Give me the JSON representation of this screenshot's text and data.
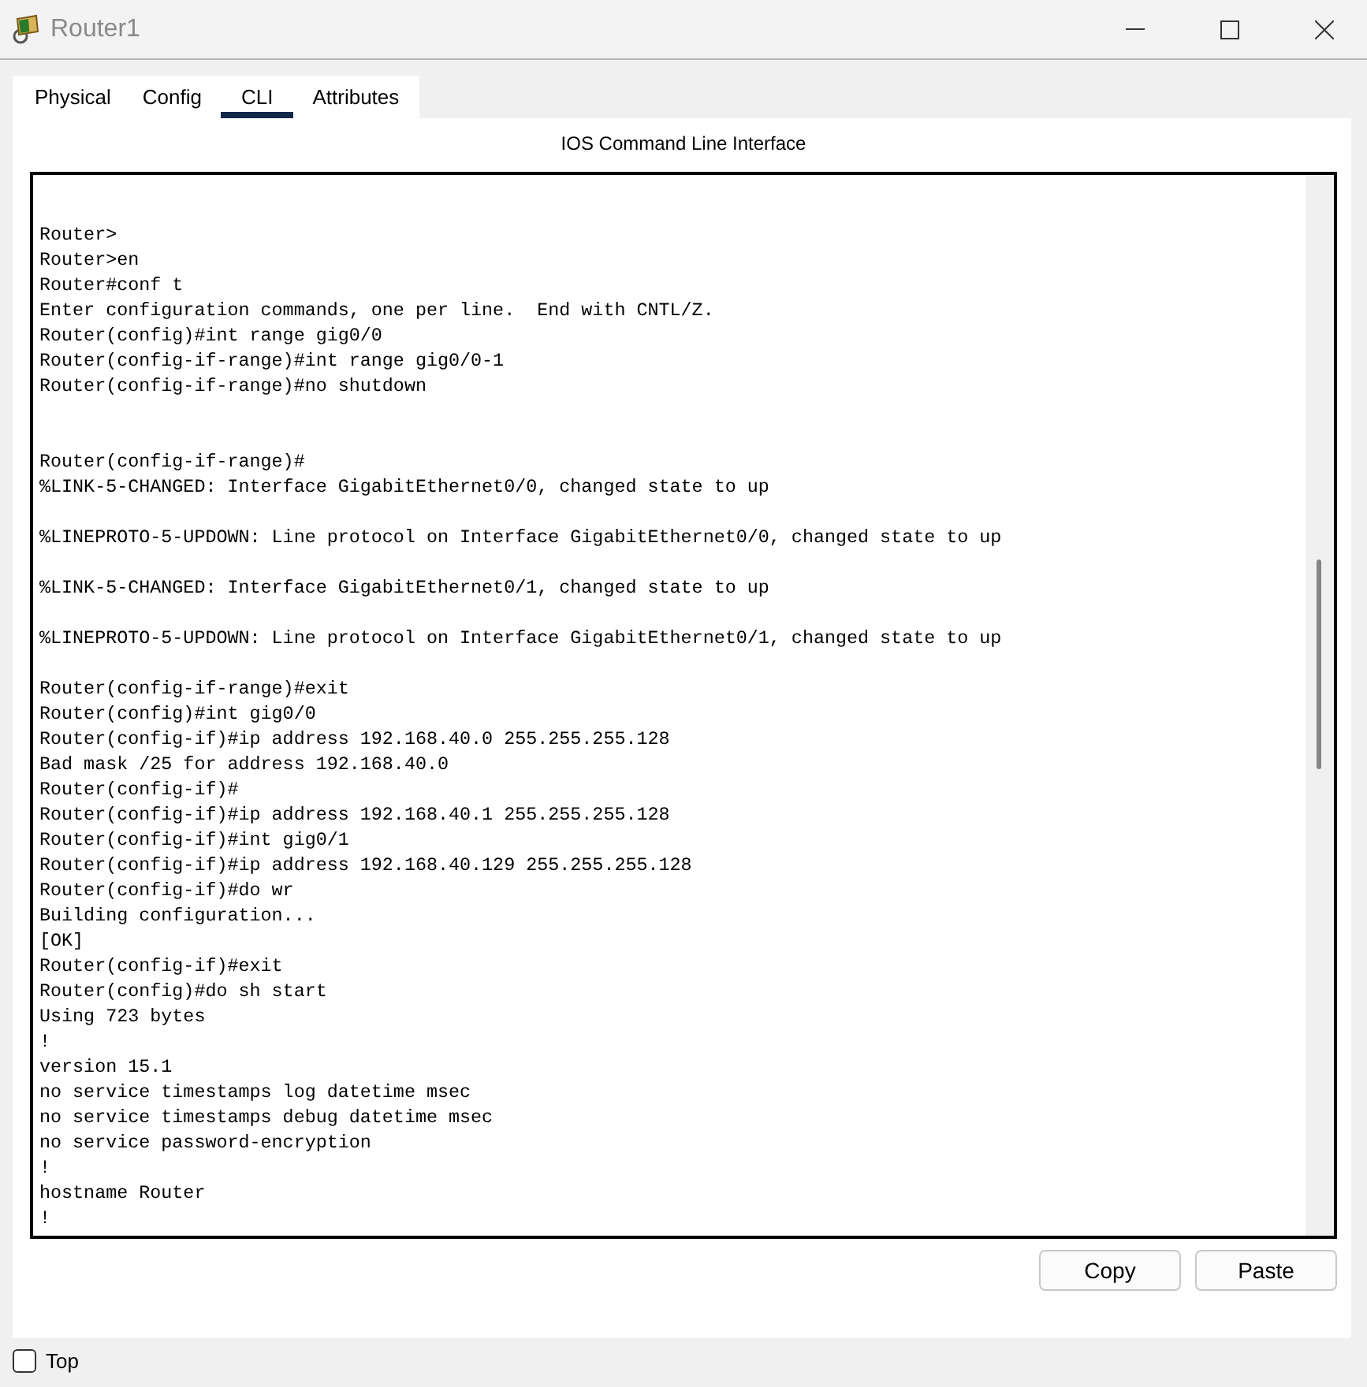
{
  "window": {
    "title": "Router1"
  },
  "tabs": [
    {
      "label": "Physical",
      "selected": false
    },
    {
      "label": "Config",
      "selected": false
    },
    {
      "label": "CLI",
      "selected": true
    },
    {
      "label": "Attributes",
      "selected": false
    }
  ],
  "panel_title": "IOS Command Line Interface",
  "terminal": {
    "lines": [
      {
        "text": "Router>"
      },
      {
        "text": "Router>en"
      },
      {
        "text": "Router#conf t"
      },
      {
        "text": "Enter configuration commands, one per line.  End with CNTL/Z."
      },
      {
        "text": "Router(config)#int range gig0/0"
      },
      {
        "text": "Router(config-if-range)#int range gig0/0-1"
      },
      {
        "text": "Router(config-if-range)#no shutdown"
      },
      {
        "text": "Router(config-if-range)#",
        "blank_before": true,
        "double_blank": true
      },
      {
        "text": "%LINK-5-CHANGED: Interface GigabitEthernet0/0, changed state to up"
      },
      {
        "text": "%LINEPROTO-5-UPDOWN: Line protocol on Interface GigabitEthernet0/0, changed state to up",
        "blank_before": true
      },
      {
        "text": "%LINK-5-CHANGED: Interface GigabitEthernet0/1, changed state to up",
        "blank_before": true
      },
      {
        "text": "%LINEPROTO-5-UPDOWN: Line protocol on Interface GigabitEthernet0/1, changed state to up",
        "blank_before": true
      },
      {
        "text": "Router(config-if-range)#exit",
        "blank_before": true
      },
      {
        "text": "Router(config)#int gig0/0"
      },
      {
        "text": "Router(config-if)#ip address 192.168.40.0 255.255.255.128"
      },
      {
        "text": "Bad mask /25 for address 192.168.40.0"
      },
      {
        "text": "Router(config-if)#"
      },
      {
        "text": "Router(config-if)#ip address 192.168.40.1 255.255.255.128"
      },
      {
        "text": "Router(config-if)#int gig0/1"
      },
      {
        "text": "Router(config-if)#ip address 192.168.40.129 255.255.255.128"
      },
      {
        "text": "Router(config-if)#do wr"
      },
      {
        "text": "Building configuration..."
      },
      {
        "text": "[OK]"
      },
      {
        "text": "Router(config-if)#exit"
      },
      {
        "text": "Router(config)#do sh start"
      },
      {
        "text": "Using 723 bytes"
      },
      {
        "text": "!"
      },
      {
        "text": "version 15.1"
      },
      {
        "text": "no service timestamps log datetime msec"
      },
      {
        "text": "no service timestamps debug datetime msec"
      },
      {
        "text": "no service password-encryption"
      },
      {
        "text": "!"
      },
      {
        "text": "hostname Router"
      },
      {
        "text": "!"
      }
    ]
  },
  "buttons": [
    "Copy",
    "Paste"
  ],
  "top_checkbox": {
    "label": "Top",
    "checked": false
  }
}
